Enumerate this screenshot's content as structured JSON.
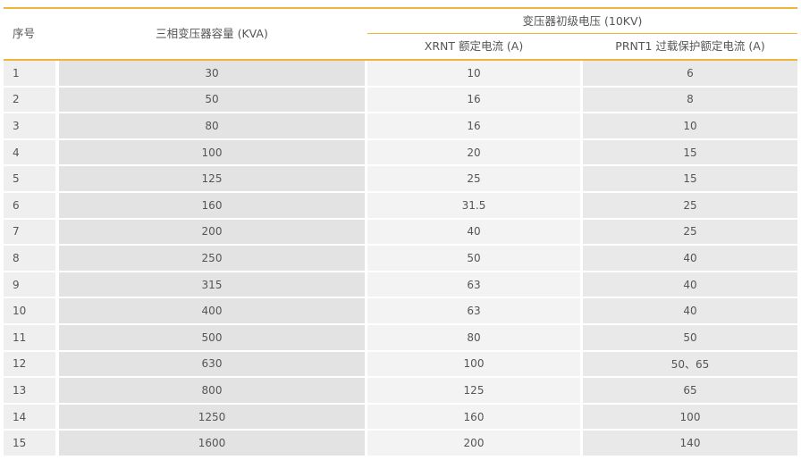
{
  "table": {
    "headers": {
      "no": "序号",
      "capacity": "三相变压器容量 (KVA)",
      "group": "变压器初级电压 (10KV)",
      "xrnt": "XRNT 额定电流 (A)",
      "prnt": "PRNT1 过载保护额定电流 (A)"
    },
    "rows": [
      {
        "no": "1",
        "capacity": "30",
        "xrnt": "10",
        "prnt": "6"
      },
      {
        "no": "2",
        "capacity": "50",
        "xrnt": "16",
        "prnt": "8"
      },
      {
        "no": "3",
        "capacity": "80",
        "xrnt": "16",
        "prnt": "10"
      },
      {
        "no": "4",
        "capacity": "100",
        "xrnt": "20",
        "prnt": "15"
      },
      {
        "no": "5",
        "capacity": "125",
        "xrnt": "25",
        "prnt": "15"
      },
      {
        "no": "6",
        "capacity": "160",
        "xrnt": "31.5",
        "prnt": "25"
      },
      {
        "no": "7",
        "capacity": "200",
        "xrnt": "40",
        "prnt": "25"
      },
      {
        "no": "8",
        "capacity": "250",
        "xrnt": "50",
        "prnt": "40"
      },
      {
        "no": "9",
        "capacity": "315",
        "xrnt": "63",
        "prnt": "40"
      },
      {
        "no": "10",
        "capacity": "400",
        "xrnt": "63",
        "prnt": "40"
      },
      {
        "no": "11",
        "capacity": "500",
        "xrnt": "80",
        "prnt": "50"
      },
      {
        "no": "12",
        "capacity": "630",
        "xrnt": "100",
        "prnt": "50、65"
      },
      {
        "no": "13",
        "capacity": "800",
        "xrnt": "125",
        "prnt": "65"
      },
      {
        "no": "14",
        "capacity": "1250",
        "xrnt": "160",
        "prnt": "100"
      },
      {
        "no": "15",
        "capacity": "1600",
        "xrnt": "200",
        "prnt": "140"
      }
    ]
  },
  "colors": {
    "accent_rule": "#f3b43c",
    "text": "#555555"
  }
}
